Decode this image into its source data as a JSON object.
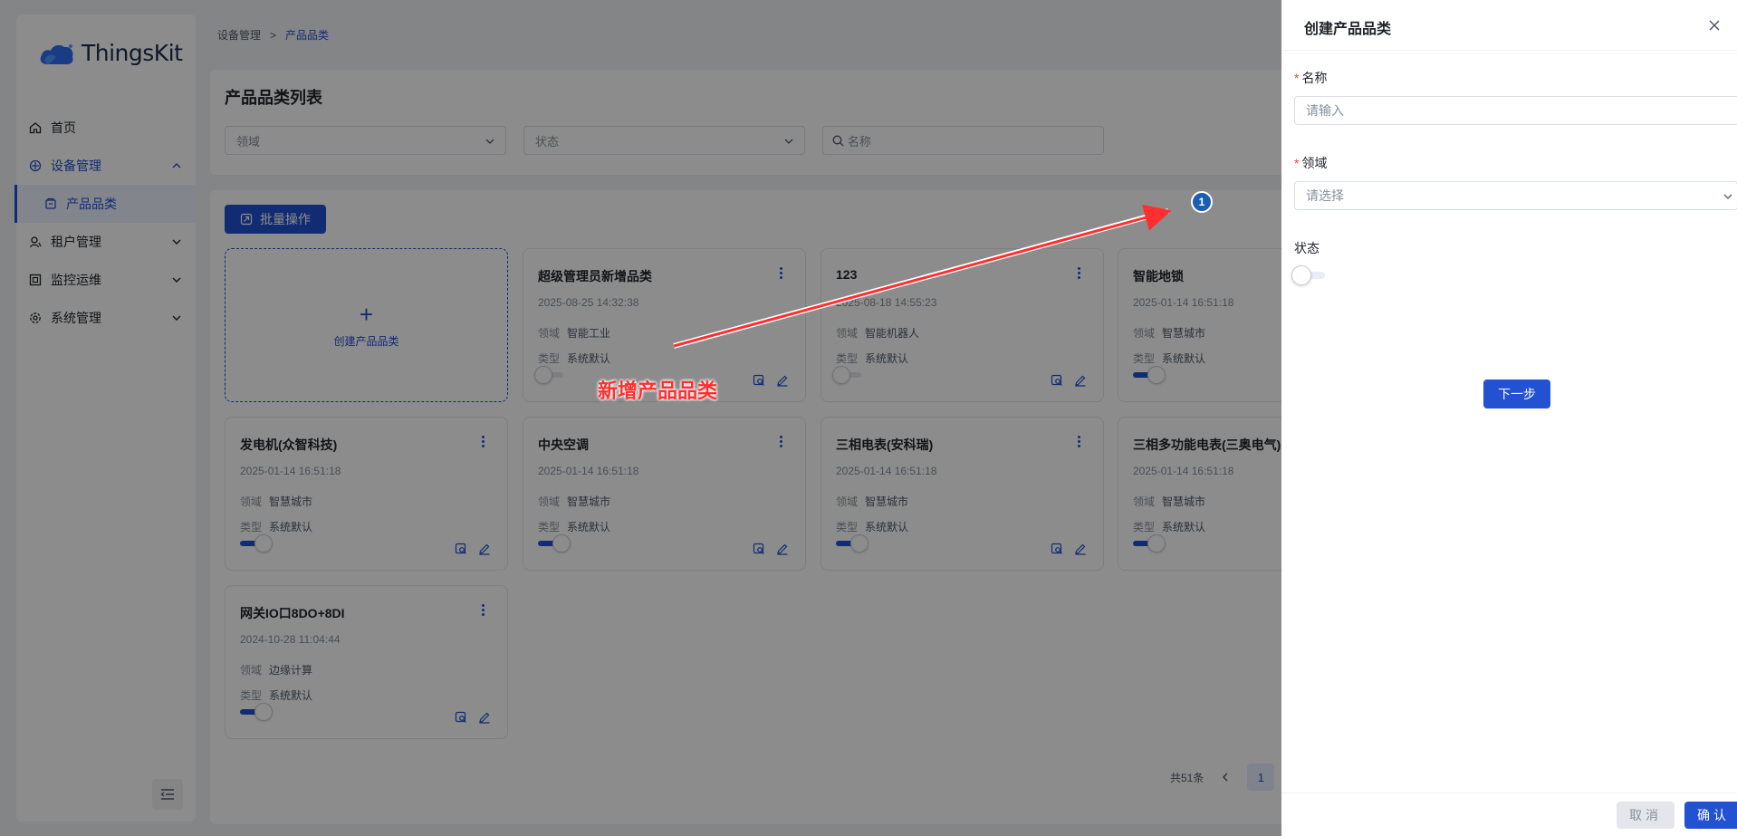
{
  "app": {
    "logo_text": "ThingsKit"
  },
  "sidebar": {
    "items": [
      {
        "label": "首页",
        "icon": "home-icon"
      },
      {
        "label": "设备管理",
        "icon": "device-icon",
        "expanded": true
      },
      {
        "label": "产品品类",
        "icon": "category-icon",
        "selected": true
      },
      {
        "label": "租户管理",
        "icon": "tenant-icon"
      },
      {
        "label": "监控运维",
        "icon": "monitor-icon"
      },
      {
        "label": "系统管理",
        "icon": "settings-icon"
      }
    ]
  },
  "breadcrumb": {
    "parent": "设备管理",
    "separator": ">",
    "current": "产品品类"
  },
  "filter": {
    "title": "产品品类列表",
    "domain_placeholder": "领域",
    "status_placeholder": "状态",
    "search_placeholder": "名称"
  },
  "toolbar": {
    "batch_label": "批量操作"
  },
  "new_card": {
    "plus": "+",
    "label": "创建产品品类"
  },
  "field_labels": {
    "domain": "领域",
    "type": "类型"
  },
  "cards": [
    {
      "title": "超级管理员新增品类",
      "time": "2025-08-25 14:32:38",
      "domain": "智能工业",
      "type": "系统默认",
      "enabled": false
    },
    {
      "title": "123",
      "time": "2025-08-18 14:55:23",
      "domain": "智能机器人",
      "type": "系统默认",
      "enabled": false
    },
    {
      "title": "智能地锁",
      "time": "2025-01-14 16:51:18",
      "domain": "智慧城市",
      "type": "系统默认",
      "enabled": true
    },
    {
      "title": "发电机(众智科技)",
      "time": "2025-01-14 16:51:18",
      "domain": "智慧城市",
      "type": "系统默认",
      "enabled": true
    },
    {
      "title": "中央空调",
      "time": "2025-01-14 16:51:18",
      "domain": "智慧城市",
      "type": "系统默认",
      "enabled": true
    },
    {
      "title": "三相电表(安科瑞)",
      "time": "2025-01-14 16:51:18",
      "domain": "智慧城市",
      "type": "系统默认",
      "enabled": true
    },
    {
      "title": "三相多功能电表(三奥电气)",
      "time": "2025-01-14 16:51:18",
      "domain": "智慧城市",
      "type": "系统默认",
      "enabled": true
    },
    {
      "title": "网关IO口8DO+8DI",
      "time": "2024-10-28 11:04:44",
      "domain": "边缘计算",
      "type": "系统默认",
      "enabled": true
    }
  ],
  "pagination": {
    "total_text": "共51条",
    "current_page": "1"
  },
  "annotation": {
    "label": "新增产品品类",
    "step": "1"
  },
  "drawer": {
    "title": "创建产品品类",
    "required_mark": "*",
    "name_label": "名称",
    "name_placeholder": "请输入",
    "domain_label": "领域",
    "domain_placeholder": "请选择",
    "status_label": "状态",
    "status_enabled": false,
    "next_label": "下一步",
    "cancel_label": "取消",
    "confirm_label": "确认"
  },
  "colors": {
    "primary": "#2251d1",
    "annotation": "#ff2f2f",
    "required": "#f53f3f"
  }
}
